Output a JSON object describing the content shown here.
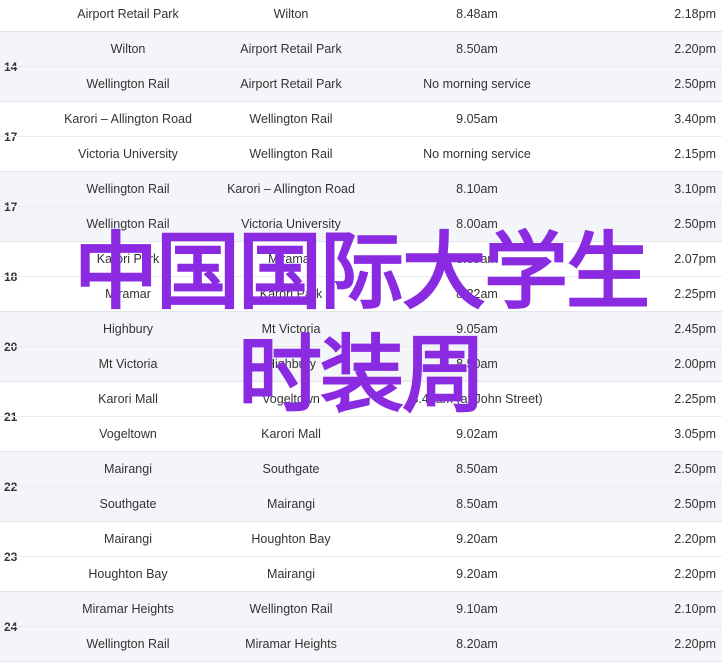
{
  "timetable": {
    "groups": [
      {
        "route": "",
        "shaded": false,
        "rows": [
          {
            "from": "Airport Retail Park",
            "to": "Wilton",
            "depart": "8.48am",
            "return": "2.18pm"
          }
        ]
      },
      {
        "route": "14",
        "shaded": true,
        "rows": [
          {
            "from": "Wilton",
            "to": "Airport Retail Park",
            "depart": "8.50am",
            "return": "2.20pm"
          },
          {
            "from": "Wellington Rail",
            "to": "Airport Retail Park",
            "depart": "No morning service",
            "return": "2.50pm"
          }
        ]
      },
      {
        "route": "17",
        "shaded": false,
        "rows": [
          {
            "from": "Karori – Allington Road",
            "to": "Wellington Rail",
            "depart": "9.05am",
            "return": "3.40pm"
          },
          {
            "from": "Victoria University",
            "to": "Wellington Rail",
            "depart": "No morning service",
            "return": "2.15pm"
          }
        ]
      },
      {
        "route": "17",
        "shaded": true,
        "rows": [
          {
            "from": "Wellington Rail",
            "to": "Karori – Allington Road",
            "depart": "8.10am",
            "return": "3.10pm"
          },
          {
            "from": "Wellington Rail",
            "to": "Victoria University",
            "depart": "8.00am",
            "return": "2.50pm"
          }
        ]
      },
      {
        "route": "18",
        "shaded": false,
        "rows": [
          {
            "from": "Karori Park",
            "to": "Miramar",
            "depart": "8.09am",
            "return": "2.07pm"
          },
          {
            "from": "Miramar",
            "to": "Karori Park",
            "depart": "8.22am",
            "return": "2.25pm"
          }
        ]
      },
      {
        "route": "20",
        "shaded": true,
        "rows": [
          {
            "from": "Highbury",
            "to": "Mt Victoria",
            "depart": "9.05am",
            "return": "2.45pm"
          },
          {
            "from": "Mt Victoria",
            "to": "Highbury",
            "depart": "8.50am",
            "return": "2.00pm"
          }
        ]
      },
      {
        "route": "21",
        "shaded": false,
        "rows": [
          {
            "from": "Karori Mall",
            "to": "Vogeltown",
            "depart": "8.40am (at John Street)",
            "return": "2.25pm"
          },
          {
            "from": "Vogeltown",
            "to": "Karori Mall",
            "depart": "9.02am",
            "return": "3.05pm"
          }
        ]
      },
      {
        "route": "22",
        "shaded": true,
        "rows": [
          {
            "from": "Mairangi",
            "to": "Southgate",
            "depart": "8.50am",
            "return": "2.50pm"
          },
          {
            "from": "Southgate",
            "to": "Mairangi",
            "depart": "8.50am",
            "return": "2.50pm"
          }
        ]
      },
      {
        "route": "23",
        "shaded": false,
        "rows": [
          {
            "from": "Mairangi",
            "to": "Houghton Bay",
            "depart": "9.20am",
            "return": "2.20pm"
          },
          {
            "from": "Houghton Bay",
            "to": "Mairangi",
            "depart": "9.20am",
            "return": "2.20pm"
          }
        ]
      },
      {
        "route": "24",
        "shaded": true,
        "rows": [
          {
            "from": "Miramar Heights",
            "to": "Wellington Rail",
            "depart": "9.10am",
            "return": "2.10pm"
          },
          {
            "from": "Wellington Rail",
            "to": "Miramar Heights",
            "depart": "8.20am",
            "return": "2.20pm"
          }
        ]
      }
    ]
  },
  "overlay": {
    "line1": "中国国际大学生",
    "line2": "时装周",
    "color": "#8a2be2"
  }
}
